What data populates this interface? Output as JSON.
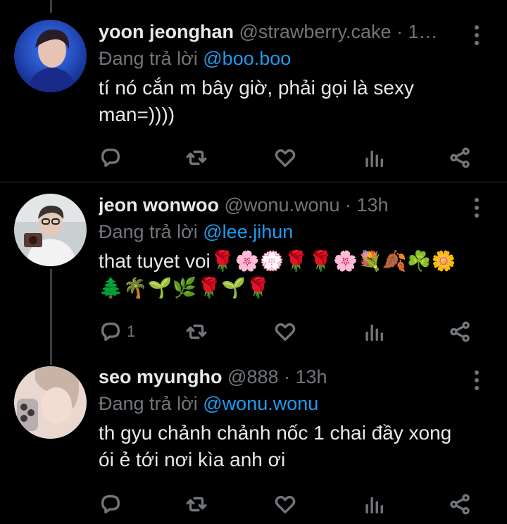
{
  "tweets": [
    {
      "name": "yoon jeonghan",
      "handle": "@strawberry.cake",
      "time_sep": " · ",
      "time": "1…",
      "reply_prefix": "Đang trả lời ",
      "reply_to": "@boo.boo",
      "text": "tí nó cắn m bây giờ, phải gọi là sexy man=))))",
      "reply_count": "",
      "avatar_color": "#1b46c9"
    },
    {
      "name": "jeon wonwoo",
      "handle": "@wonu.wonu",
      "time_sep": " · ",
      "time": "13h",
      "reply_prefix": "Đang trả lời ",
      "reply_to": "@lee.jihun",
      "text": "that tuyet voi🌹🌸💮🌹🌹🌸💐🍂☘️🌼🌲🌴🌱🌿🌹🌱🌹",
      "reply_count": "1",
      "avatar_color": "#cfd5d6"
    },
    {
      "name": "seo myungho",
      "handle": "@888",
      "time_sep": " · ",
      "time": "13h",
      "reply_prefix": "Đang trả lời ",
      "reply_to": "@wonu.wonu",
      "text": "th gyu chảnh chảnh nốc 1 chai đầy xong ói ẻ tới nơi kìa anh ơi",
      "reply_count": "",
      "avatar_color": "#d8c6bc"
    }
  ],
  "icons": {
    "reply": "reply-icon",
    "retweet": "retweet-icon",
    "like": "heart-icon",
    "views": "views-icon",
    "share": "share-icon",
    "more": "more-vertical-icon"
  },
  "colors": {
    "background": "#000000",
    "primary_text": "#e7e9ea",
    "secondary_text": "#71767b",
    "mention": "#1d9bf0",
    "divider": "#2f3336"
  }
}
